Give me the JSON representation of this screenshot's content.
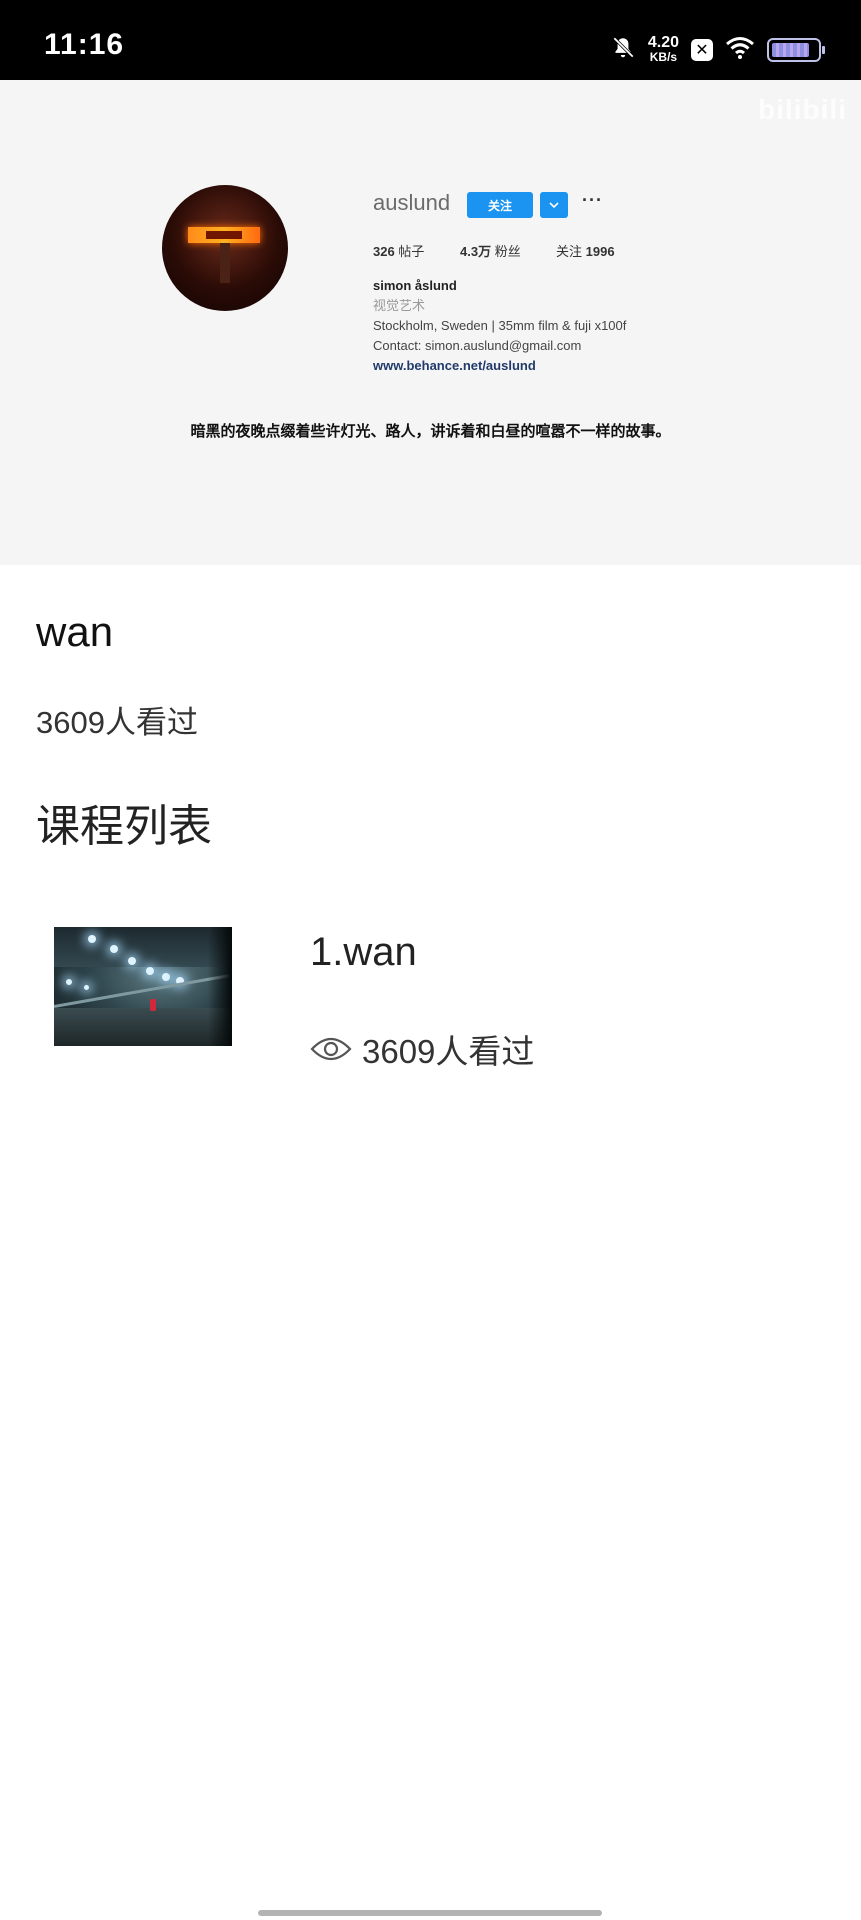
{
  "status_bar": {
    "time": "11:16",
    "net_speed_value": "4.20",
    "net_speed_unit": "KB/s",
    "icons": [
      "bell-muted-icon",
      "close-box-icon",
      "wifi-icon",
      "battery-icon"
    ],
    "battery_level": 0.85
  },
  "banner": {
    "watermark": "bilibili",
    "username": "auslund",
    "follow_button": "关注",
    "more_button": "···",
    "stats": {
      "posts_count": "326",
      "posts_label": "帖子",
      "followers_count": "4.3万",
      "followers_label": "粉丝",
      "following_label": "关注",
      "following_count": "1996"
    },
    "bio": {
      "name": "simon åslund",
      "category": "视觉艺术",
      "line1": "Stockholm, Sweden | 35mm film & fuji x100f",
      "line2": "Contact: simon.auslund@gmail.com",
      "link": "www.behance.net/auslund"
    },
    "caption": "暗黑的夜晚点缀着些许灯光、路人，讲诉着和白昼的喧嚣不一样的故事。"
  },
  "course": {
    "title": "wan",
    "views": "3609人看过"
  },
  "section": {
    "title": "课程列表"
  },
  "lessons": [
    {
      "title": "1.wan",
      "views": "3609人看过"
    }
  ],
  "colors": {
    "accent": "#1a94f0",
    "status_bar_bg": "#000000",
    "banner_bg": "#f5f5f6"
  }
}
